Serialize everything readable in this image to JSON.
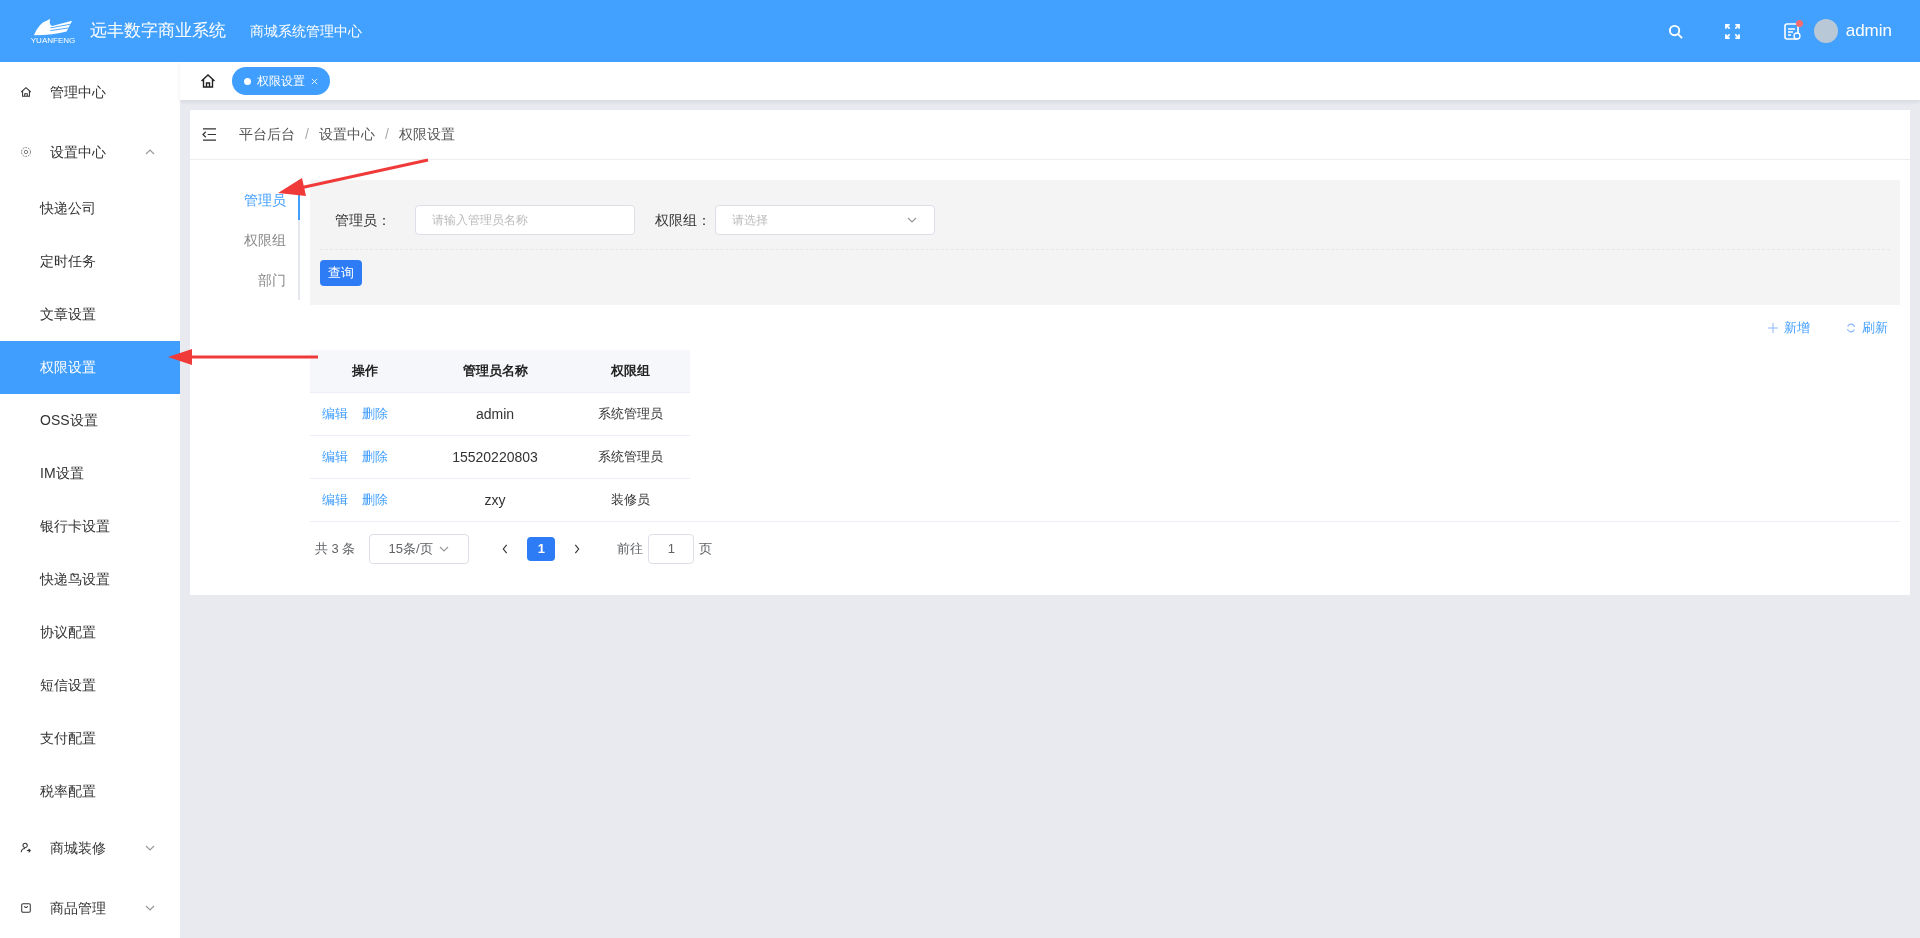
{
  "header": {
    "brand": "远丰数字商业系统",
    "logo_text": "YUANFENG",
    "subtitle": "商城系统管理中心",
    "notification_dot": true,
    "user": "admin"
  },
  "sidebar": {
    "items": [
      {
        "kind": "link",
        "label": "管理中心",
        "selected": false
      },
      {
        "kind": "group",
        "label": "设置中心",
        "expanded": true,
        "children": [
          {
            "label": "快递公司",
            "selected": false
          },
          {
            "label": "定时任务",
            "selected": false
          },
          {
            "label": "文章设置",
            "selected": false
          },
          {
            "label": "权限设置",
            "selected": true
          },
          {
            "label": "OSS设置",
            "selected": false
          },
          {
            "label": "IM设置",
            "selected": false
          },
          {
            "label": "银行卡设置",
            "selected": false
          },
          {
            "label": "快递鸟设置",
            "selected": false
          },
          {
            "label": "协议配置",
            "selected": false
          },
          {
            "label": "短信设置",
            "selected": false
          },
          {
            "label": "支付配置",
            "selected": false
          },
          {
            "label": "税率配置",
            "selected": false
          }
        ]
      },
      {
        "kind": "group",
        "label": "商城装修",
        "expanded": false
      },
      {
        "kind": "group",
        "label": "商品管理",
        "expanded": false
      }
    ]
  },
  "open_tabs": [
    {
      "label": "权限设置",
      "selected": true
    }
  ],
  "breadcrumb": [
    {
      "kind": "item",
      "text": "平台后台"
    },
    {
      "kind": "separator",
      "text": "/"
    },
    {
      "kind": "item",
      "text": "设置中心"
    },
    {
      "kind": "separator",
      "text": "/"
    },
    {
      "kind": "current",
      "text": "权限设置"
    }
  ],
  "side_tabs": [
    {
      "label": "管理员",
      "selected": true
    },
    {
      "label": "权限组",
      "selected": false
    },
    {
      "label": "部门",
      "selected": false
    }
  ],
  "filters": {
    "name_label": "管理员：",
    "name_placeholder": "请输入管理员名称",
    "group_label": "权限组：",
    "group_placeholder": "请选择",
    "query_button": "查询"
  },
  "toolbar": {
    "add": "新增",
    "refresh": "刷新"
  },
  "table": {
    "columns": [
      "操作",
      "管理员名称",
      "权限组"
    ],
    "rows": [
      {
        "actions": [
          "编辑",
          "删除"
        ],
        "name": "admin",
        "group": "系统管理员"
      },
      {
        "actions": [
          "编辑",
          "删除"
        ],
        "name": "15520220803",
        "group": "系统管理员"
      },
      {
        "actions": [
          "编辑",
          "删除"
        ],
        "name": "zxy",
        "group": "装修员"
      }
    ]
  },
  "pagination": {
    "total": "共 3 条",
    "page_size": "15条/页",
    "pages": [
      {
        "label": "1",
        "selected": true
      }
    ],
    "goto_label": "前往",
    "goto_value": "1",
    "goto_suffix": "页"
  }
}
